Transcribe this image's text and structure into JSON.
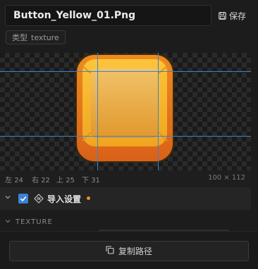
{
  "header": {
    "filename": "Button_Yellow_01.Png",
    "save_label": "保存",
    "save_icon": "floppy-disk-icon"
  },
  "type_badge": {
    "key": "类型",
    "value": "texture"
  },
  "preview": {
    "sprite_colors": {
      "outer": "#e8741c",
      "rim": "#f5b22a",
      "face_top": "#f4c76a",
      "face_bottom": "#e39a2e"
    },
    "guide_color": "#3a84c9",
    "background": "checkerboard"
  },
  "border_info": {
    "left_label": "左",
    "left_value": "24",
    "right_label": "右",
    "right_value": "22",
    "top_label": "上",
    "top_value": "25",
    "bottom_label": "下",
    "bottom_value": "31",
    "size": "100 × 112"
  },
  "import_settings": {
    "label": "导入设置",
    "checked": true,
    "modified_indicator_color": "#e8922a",
    "expand_icon": "chevron-down-icon",
    "settings_icon": "sliders-icon"
  },
  "texture_section": {
    "label": "TEXTURE",
    "collapse_icon": "chevron-down-icon"
  },
  "footer": {
    "copy_path_label": "复制路径",
    "copy_icon": "copy-icon"
  }
}
